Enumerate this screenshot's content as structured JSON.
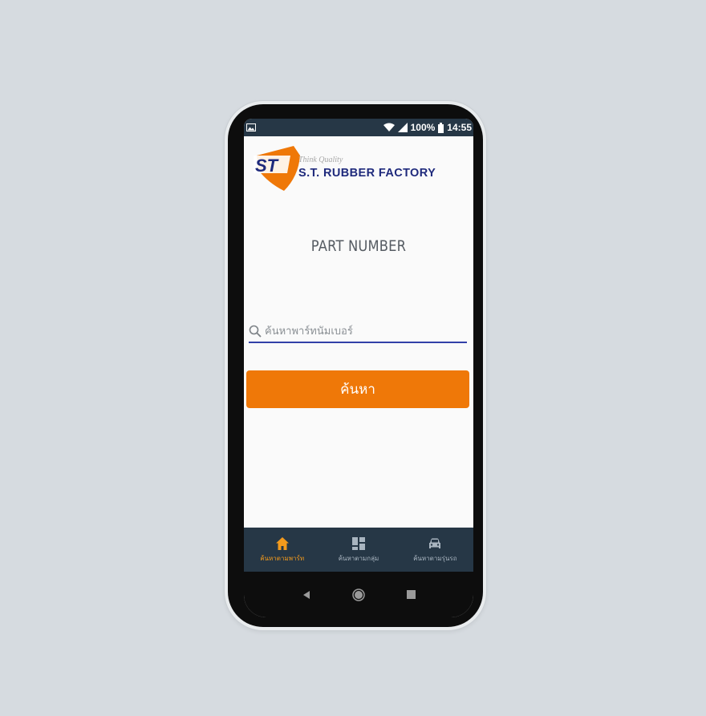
{
  "status_bar": {
    "battery": "100%",
    "time": "14:55"
  },
  "logo": {
    "tagline": "Think Quality",
    "company": "S.T. RUBBER FACTORY",
    "mark": "ST"
  },
  "page": {
    "title": "PART NUMBER"
  },
  "search": {
    "placeholder": "ค้นหาพาร์ทนัมเบอร์",
    "value": ""
  },
  "search_button": {
    "label": "ค้นหา"
  },
  "bottom_nav": {
    "items": [
      {
        "label": "ค้นหาตามพาร์ท",
        "icon": "home-icon",
        "active": true
      },
      {
        "label": "ค้นหาตามกลุ่ม",
        "icon": "grid-icon",
        "active": false
      },
      {
        "label": "ค้นหาตามรุ่นรถ",
        "icon": "car-icon",
        "active": false
      }
    ]
  },
  "colors": {
    "accent": "#ef7808",
    "nav_bg": "#263746",
    "brand_blue": "#1f2a7c",
    "underline": "#3240a8"
  }
}
